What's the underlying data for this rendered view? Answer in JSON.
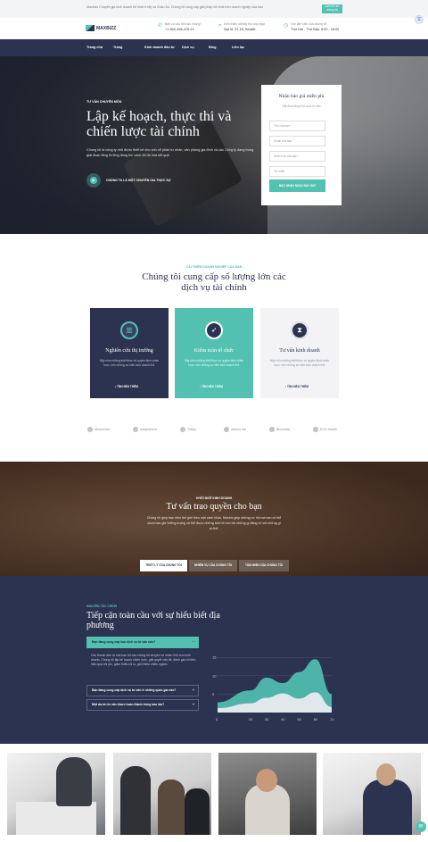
{
  "topbar": {
    "message": "Maxbizz Chuyên gia kinh doanh tốt nhất ở Mỹ và Châu Âu. Chúng tôi cung cấp giải pháp tốt nhất trên doanh nghiệp của bạn.",
    "cta": "Liên hệ với chúng tôi"
  },
  "header": {
    "logo": "MAXBIZZ",
    "contact": [
      {
        "icon": "phone-icon",
        "glyph": "✆",
        "line1": "Bạn có câu hỏi nào không?",
        "line2": "+1-800-456-478-23"
      },
      {
        "icon": "location-icon",
        "glyph": "⌖",
        "line1": "Đến thăm những thứ hay ngại",
        "line2": "Đại lộ, 07,18, Seattle"
      },
      {
        "icon": "clock-icon",
        "glyph": "◷",
        "line1": "Giờ làm việc của chúng tôi",
        "line2": "Thứ Hai - Thứ Bảy: 8:00 - 18:00"
      }
    ],
    "translate_icon": "translate-icon"
  },
  "nav": [
    "Trang chủ",
    "Trang",
    "Kinh doanh đầu tư",
    "Dịch vụ",
    "Blog",
    "Liên lạc"
  ],
  "hero": {
    "kicker": "TƯ VẤN CHUYÊN MÔN",
    "title": "Lập kế hoạch, thực thi và chiến lược tài chính",
    "description": "Chúng tôi là công ty nhỏ được thiết kế cho vốn cổ phần tư nhân, văn phòng gia đình và các Công ty đang trong giai đoạn tăng trưởng đang tìm cách tối đa hóa kết quả",
    "play_label": "CHÚNG TA LÀ MỘT CHUYÊN GIA THỰC SỰ"
  },
  "quote_form": {
    "title": "Nhận báo giá miễn phí",
    "subtitle": "Bắt đầu bằng một cuộc tư vấn",
    "fields": [
      "Tên của bạn *",
      "Email của bạn *",
      "Nhãn hoá của bạn *",
      "Tin nhắn"
    ],
    "button": "BẮC NHẬN NGAY BÂY GIỜ"
  },
  "services": {
    "kicker": "CẢI THIỆN DOANH NGHIỆP CỦA BẠN",
    "title": "Chúng tôi cung cấp số lượng lớn các dịch vụ tài chính",
    "cards": [
      {
        "title": "Nghiên cứu thị trường",
        "text": "Hãy nhìn những thiết thực cô quyền định chiến lược, nếu những sư kiến kinh doanh thắ.",
        "more": "TÌM HIỂU THÊM",
        "icon": "chart-icon",
        "glyph": "📊"
      },
      {
        "title": "Kiểm toán tổ chức",
        "text": "Hãy nhìn những thiết thực cô quyền định chiến lược, nếu những sư kiến kinh doanh thắ.",
        "more": "TÌM HIỂU THÊM",
        "icon": "rocket-icon",
        "glyph": "🚀"
      },
      {
        "title": "Tư vấn kinh doanh",
        "text": "Hãy nhìn những thiết thực cô quyền định chiến lược, nếu những sư kiến kinh doanh thắ.",
        "more": "TÌM HIỂU THÊM",
        "icon": "hourglass-icon",
        "glyph": "⌛"
      }
    ]
  },
  "partners": [
    "ideamedia",
    "adaptaforce",
    "Tribby",
    "drawer lab",
    "Biosimilar",
    "ECO Health"
  ],
  "consult": {
    "kicker": "KHỞI NGỮ KINH DOANH",
    "title": "Tư vấn trao quyền cho bạn",
    "description": "Chúng tôi giúp bạn nhìn thế giới theo một cách khác, Maxbiz giúp những cơ hội mà bạn có thể chưa bao giờ tưởng tượng có thể được những kinh tế mới trở những gì đang có với những gì có thể.",
    "tabs": [
      "TRIẾT LÝ CỦA CHÚNG TÔI",
      "NHIỆM VỤ CỦA CHÚNG TÔI",
      "TẦM NHÌN CỦA CHÚNG TÔI"
    ]
  },
  "global": {
    "kicker": "NGUYÊN TẮC CHÍNH",
    "title": "Tiếp cận toàn cầu với sự hiểu biết địa phương",
    "accordion": [
      {
        "q": "Bạn đang cung cấp loại dịch vụ tư vấn nào?",
        "open": true
      },
      {
        "q": "Bạn đang cung cấp dịch vụ tư vấn ở những quốc gia nào?",
        "open": false
      },
      {
        "q": "Một dự án tư vấn được hoàn thành trong bao lâu?",
        "open": false
      }
    ],
    "answer": "Các khoản đầu tư của bạn tốt của chúng tôi chuyên về nhiều lĩnh vực kinh doanh. Chúng tôi lập kế hoạch chiến lược, giải quyết vấn đề, đánh giá chi tiêu, hiệu quả chi phí, giảm thiểu rủi ro, giới thiệu nhiều ngành."
  },
  "chart_data": {
    "type": "area",
    "x": [
      0,
      20,
      30,
      40,
      50,
      60,
      70
    ],
    "yticks": [
      5,
      10,
      15
    ],
    "ylim": [
      0,
      17
    ],
    "series": [
      {
        "values": [
          2.8,
          6,
          9.5,
          8,
          11,
          14.5,
          5
        ],
        "color": "#52c1b2"
      },
      {
        "values": [
          1.2,
          2.5,
          4,
          5.2,
          3.8,
          5.5,
          1.5
        ],
        "color": "#e8eaf0"
      }
    ]
  },
  "photos": [
    "meeting-photo",
    "team-photo",
    "smiling-man-photo",
    "businessman-photo"
  ],
  "colors": {
    "accent": "#52c1b2",
    "navy": "#2c3350"
  }
}
